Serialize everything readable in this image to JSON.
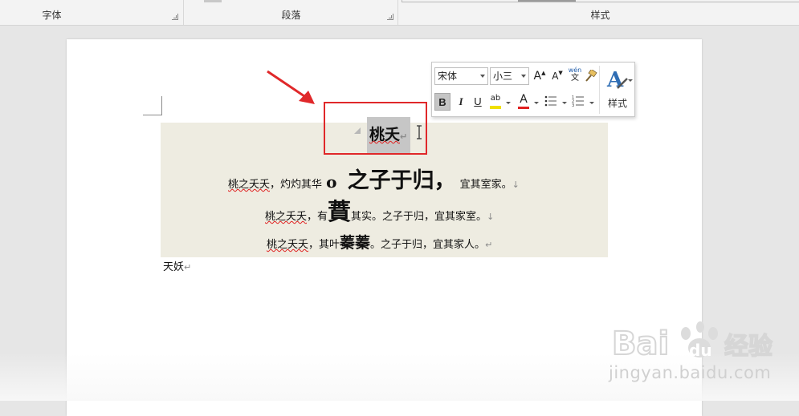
{
  "ribbon": {
    "groups": [
      "字体",
      "段落",
      "样式"
    ]
  },
  "mini_toolbar": {
    "font_name": "宋体",
    "font_size": "小三",
    "grow_label": "A",
    "shrink_label": "A",
    "phonetic_top": "wén",
    "phonetic_bottom": "文",
    "bold": "B",
    "italic": "I",
    "underline": "U",
    "highlight": "ab",
    "font_color": "A",
    "styles_label": "样式",
    "highlight_color": "#f0e000",
    "font_color_bar": "#e02020"
  },
  "document": {
    "title": "桃夭",
    "line1": {
      "a": "桃之夭夭",
      "b": "，灼灼其华",
      "c": "o",
      "d": "之子于归，",
      "e": "宜其室家。"
    },
    "line2": {
      "a": "桃之夭夭",
      "b": "，有",
      "c": "蕡",
      "d": "其实。之子于归，宜其家室。"
    },
    "line3": {
      "a": "桃之夭夭",
      "b": "，其叶",
      "c": "蓁蓁",
      "d": "。之子于归，宜其家人。"
    },
    "line4": "天妖",
    "para_mark": "↵",
    "break_mark": "↓"
  },
  "colors": {
    "shading": "#eeece1",
    "annotation_red": "#e0282a"
  },
  "watermark": {
    "logo": "Bai du 经验",
    "site": "jingyan.baidu.com"
  }
}
